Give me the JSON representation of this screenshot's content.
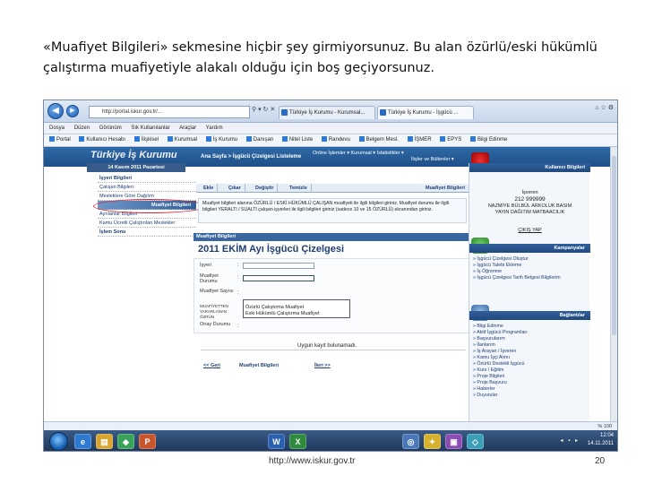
{
  "slide": {
    "caption": "«Muafiyet Bilgileri» sekmesine hiçbir şey girmiyorsunuz. Bu alan özürlü/eski hükümlü çalıştırma muafiyetiyle alakalı olduğu için boş geçiyorsunuz.",
    "footer_url": "http://www.iskur.gov.tr",
    "page_number": "20"
  },
  "browser": {
    "back": "◀",
    "forward": "▶",
    "url": "http://portal.iskur.gov.tr/...",
    "url_icons": "⚲ ▾ ↻ ✕",
    "tabs": [
      {
        "label": "Türkiye İş Kurumu - Kurumsal..."
      },
      {
        "label": "Türkiye İş Kurumu - İşgücü ..."
      }
    ],
    "window_controls": "⌂ ☆ ⚙",
    "menu": [
      "Dosya",
      "Düzen",
      "Görünüm",
      "Sık Kullanılanlar",
      "Araçlar",
      "Yardım"
    ],
    "favorites": [
      "Portal",
      "Kullanıcı Hesabı",
      "İlişkisel",
      "Kurumsal",
      "İş Kurumu",
      "Danışan",
      "Nitel Liste",
      "Randevu",
      "Belgem Mesl.",
      "İŞMER",
      "EPYS",
      "Bilgi Edinme"
    ]
  },
  "site": {
    "logo": "Türkiye İş Kurumu",
    "date": "14 Kasım 2011 Pazartesi",
    "breadcrumb": "Ana Sayfa > İşgücü Çizelgesi Listeleme",
    "top_links_1": "Online İşlemler ▾   Kurumsal ▾   İstatistikler ▾",
    "top_links_2": "İlişler ve Bültenler ▾",
    "left_menu": [
      {
        "label": "İşyeri Bilgileri"
      },
      {
        "label": "Çalışan Bilgileri"
      },
      {
        "label": "Mesleklere Göre Dağılım"
      },
      {
        "label": "Muafiyet Bilgileri"
      },
      {
        "label": "Ayrılanlar Bilgileri"
      },
      {
        "label": "Kamu Ücretli Çalıştırılan Meslekler"
      },
      {
        "label": "İşlem Sonu"
      }
    ],
    "content_tabs": [
      "Ekle",
      "Çıkar",
      "Değiştir",
      "Temizle"
    ],
    "content_tab_right": "Muafiyet Bilgileri",
    "info_text": "Muafiyet bilgileri alanına ÖZÜRLÜ / ESKİ HÜKÜMLÜ ÇALIŞAN muafiyeti ile ilgili bilgileri giriniz. Muafiyet durumu ile ilgili bilgileri YERALTI / SUALTI çalışan işyerleri ile ilgili bilgileri giriniz (sadece 10 ve 15 ÖZÜRLÜ) ekranından giriniz.",
    "section_header": "Muafiyet Bilgileri",
    "chart_title": "2011 EKİM Ayı İşgücü Çizelgesi",
    "form_labels": [
      "İşyeri",
      "Muafiyet Durumu",
      "Muafiyet Sayısı",
      "MUAFİYETTEN YARARLANAN ÖZRÜN",
      "Onay Durumu"
    ],
    "dropdown_options": [
      "Özürlü Çalıştırma Muafiyet",
      "Eski Hükümlü Çalıştırma Muafiyet"
    ],
    "no_record": "Uygun kayıt bulunamadı.",
    "prev_link": "<< Geri",
    "current_step": "Muafiyet Bilgileri",
    "next_link": "İleri >>"
  },
  "right_panel": {
    "user_header": "Kullanıcı Bilgileri",
    "user_role": "İşveren",
    "user_id": "212 999999",
    "user_name": "NAZMİYE BÜLBÜL ARKOLUK BASIM",
    "user_company": "YAYIN DAĞITIM MATBAACILIK",
    "logout": "ÇIKIŞ YAP",
    "campaigns_header": "Kampanyalar",
    "campaigns": [
      "» İşgücü Çizelgesi Oluştur",
      "» İşgücü Talebi Ekleme",
      "» İş Öğrenme",
      "» İşgücü Çizelgesi Tarih Belgesi Bilgilerim"
    ],
    "links_header": "Bağlantılar",
    "links": [
      "» Bilgi Edinme",
      "» Aktif İşgücü Programları",
      "» Başvurularım",
      "» İlanlarım",
      "» İş Arayan / İşveren",
      "» Kamu İşçi Alımı",
      "» Özürlü Destekli İşgücü",
      "» Kurs / Eğitim",
      "» Proje Bilgileri",
      "» Proje Başvuru",
      "» Haberler",
      "» Duyurular"
    ]
  },
  "statusbar": {
    "zoom": "% 100"
  },
  "taskbar": {
    "icons": [
      "e",
      "▤",
      "◆",
      "P",
      "W",
      "X",
      "◎",
      "✦",
      "▣",
      "◇"
    ],
    "tray_icons": "◂ ▪ ▸",
    "time": "12:04",
    "date": "14.11.2011"
  }
}
